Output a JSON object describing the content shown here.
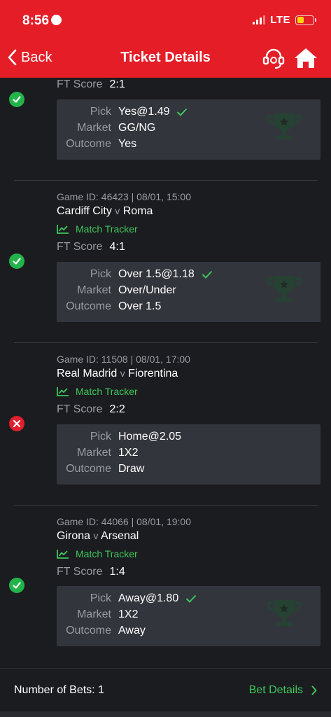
{
  "status_bar": {
    "time": "8:56",
    "network": "LTE"
  },
  "header": {
    "back_label": "Back",
    "title": "Ticket Details"
  },
  "labels": {
    "ft_score": "FT Score",
    "pick": "Pick",
    "market": "Market",
    "outcome": "Outcome",
    "match_tracker": "Match Tracker",
    "versus": "v"
  },
  "games": [
    {
      "status": "won",
      "ft_score": "2:1",
      "pick": "Yes@1.49",
      "market": "GG/NG",
      "outcome": "Yes"
    },
    {
      "status": "won",
      "meta": "Game ID: 46423 | 08/01, 15:00",
      "home": "Cardiff City",
      "away": "Roma",
      "ft_score": "4:1",
      "pick": "Over 1.5@1.18",
      "market": "Over/Under",
      "outcome": "Over 1.5"
    },
    {
      "status": "lost",
      "meta": "Game ID: 11508 | 08/01, 17:00",
      "home": "Real Madrid",
      "away": "Fiorentina",
      "ft_score": "2:2",
      "pick": "Home@2.05",
      "market": "1X2",
      "outcome": "Draw"
    },
    {
      "status": "won",
      "meta": "Game ID: 44066 | 08/01, 19:00",
      "home": "Girona",
      "away": "Arsenal",
      "ft_score": "1:4",
      "pick": "Away@1.80",
      "market": "1X2",
      "outcome": "Away"
    }
  ],
  "footer": {
    "bets_count": "Number of Bets: 1",
    "bet_details": "Bet Details"
  },
  "colors": {
    "header_red": "#e41d27",
    "win_green": "#22b34a",
    "loss_red": "#e0202e",
    "accent_green": "#3ec75a"
  },
  "icons": [
    "chevron-left-icon",
    "headset-icon",
    "home-icon",
    "check-circle-icon",
    "x-circle-icon",
    "chart-line-icon",
    "checkmark-icon",
    "trophy-icon",
    "chevron-right-icon"
  ]
}
